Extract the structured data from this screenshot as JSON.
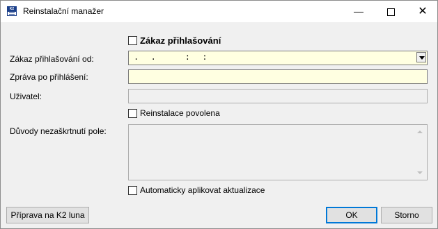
{
  "window": {
    "title": "Reinstalační manažer",
    "app_icon_text": "K2",
    "controls": {
      "minimize": "—",
      "close": "✕"
    }
  },
  "form": {
    "login_ban": {
      "label": "Zákaz přihlašování",
      "checked": false
    },
    "login_ban_from": {
      "label": "Zákaz přihlašování od:",
      "value": ".  .     :  :"
    },
    "message_after_login": {
      "label": "Zpráva po přihlášení:",
      "value": ""
    },
    "user": {
      "label": "Uživatel:",
      "value": ""
    },
    "reinstall_allowed": {
      "label": "Reinstalace povolena",
      "checked": false
    },
    "reasons": {
      "label": "Důvody nezaškrtnutí pole:",
      "value": ""
    },
    "auto_apply": {
      "label": "Automaticky aplikovat aktualizace",
      "checked": false
    }
  },
  "buttons": {
    "prepare": "Příprava na K2 luna",
    "ok": "OK",
    "cancel": "Storno"
  },
  "colors": {
    "editable_field_bg": "#ffffe1",
    "readonly_field_bg": "#f0f0f0",
    "dialog_bg": "#f0f0f0",
    "default_button_border": "#0078d7"
  }
}
